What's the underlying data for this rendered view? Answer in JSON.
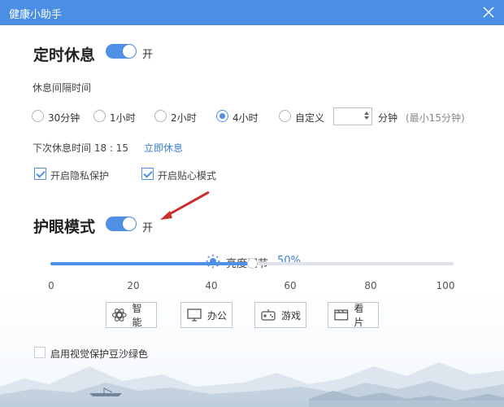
{
  "window": {
    "title": "健康小助手"
  },
  "rest": {
    "title": "定时休息",
    "toggle_label": "开",
    "interval_label": "休息间隔时间",
    "options": [
      {
        "label": "30分钟",
        "checked": false
      },
      {
        "label": "1小时",
        "checked": false
      },
      {
        "label": "2小时",
        "checked": false
      },
      {
        "label": "4小时",
        "checked": true
      },
      {
        "label": "自定义",
        "checked": false
      }
    ],
    "custom_value": "",
    "custom_unit": "分钟",
    "custom_hint": "(最小15分钟)",
    "next_rest_text": "下次休息时间 18 : 15",
    "rest_now_link": "立即休息",
    "privacy_label": "开启隐私保护",
    "care_label": "开启贴心模式"
  },
  "eye": {
    "title": "护眼模式",
    "toggle_label": "开",
    "brightness_label": "亮度调节",
    "brightness_value": "50%",
    "brightness_level": 50,
    "ticks": [
      "0",
      "20",
      "40",
      "60",
      "80",
      "100"
    ],
    "modes": [
      {
        "label": "智能",
        "icon": "smart-icon"
      },
      {
        "label": "办公",
        "icon": "monitor-icon"
      },
      {
        "label": "游戏",
        "icon": "gamepad-icon"
      },
      {
        "label": "看片",
        "icon": "film-icon"
      }
    ]
  },
  "footer": {
    "green_label": "启用视觉保护豆沙绿色"
  },
  "colors": {
    "accent": "#4f8fe5",
    "titlebar": "#4a8fe3"
  }
}
